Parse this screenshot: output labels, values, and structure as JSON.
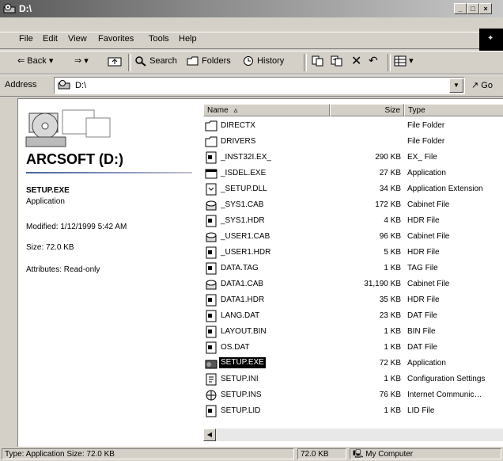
{
  "window": {
    "title": "D:\\"
  },
  "menu": {
    "items": [
      "File",
      "Edit",
      "View",
      "Favorites",
      "Tools",
      "Help"
    ]
  },
  "toolbar": {
    "back_label": "Back",
    "search_label": "Search",
    "folders_label": "Folders",
    "history_label": "History"
  },
  "address": {
    "label": "Address",
    "value": "D:\\",
    "go_label": "Go"
  },
  "left_pane": {
    "drive_title": "ARCSOFT (D:)",
    "selected_name": "SETUP.EXE",
    "selected_type": "Application",
    "modified": "Modified: 1/12/1999 5:42 AM",
    "size": "Size: 72.0 KB",
    "attributes": "Attributes: Read-only"
  },
  "list": {
    "columns": {
      "name": "Name",
      "size": "Size",
      "type": "Type"
    },
    "files": [
      {
        "name": "DIRECTX",
        "size": "",
        "type": "File Folder",
        "icon": "folder-icon"
      },
      {
        "name": "DRIVERS",
        "size": "",
        "type": "File Folder",
        "icon": "folder-icon"
      },
      {
        "name": "_INST32I.EX_",
        "size": "290 KB",
        "type": "EX_ File",
        "icon": "file-icon"
      },
      {
        "name": "_ISDEL.EXE",
        "size": "27 KB",
        "type": "Application",
        "icon": "app-icon"
      },
      {
        "name": "_SETUP.DLL",
        "size": "34 KB",
        "type": "Application Extension",
        "icon": "dll-icon"
      },
      {
        "name": "_SYS1.CAB",
        "size": "172 KB",
        "type": "Cabinet File",
        "icon": "cab-icon"
      },
      {
        "name": "_SYS1.HDR",
        "size": "4 KB",
        "type": "HDR File",
        "icon": "file-icon"
      },
      {
        "name": "_USER1.CAB",
        "size": "96 KB",
        "type": "Cabinet File",
        "icon": "cab-icon"
      },
      {
        "name": "_USER1.HDR",
        "size": "5 KB",
        "type": "HDR File",
        "icon": "file-icon"
      },
      {
        "name": "DATA.TAG",
        "size": "1 KB",
        "type": "TAG File",
        "icon": "file-icon"
      },
      {
        "name": "DATA1.CAB",
        "size": "31,190 KB",
        "type": "Cabinet File",
        "icon": "cab-icon"
      },
      {
        "name": "DATA1.HDR",
        "size": "35 KB",
        "type": "HDR File",
        "icon": "file-icon"
      },
      {
        "name": "LANG.DAT",
        "size": "23 KB",
        "type": "DAT File",
        "icon": "file-icon"
      },
      {
        "name": "LAYOUT.BIN",
        "size": "1 KB",
        "type": "BIN File",
        "icon": "file-icon"
      },
      {
        "name": "OS.DAT",
        "size": "1 KB",
        "type": "DAT File",
        "icon": "file-icon"
      },
      {
        "name": "SETUP.EXE",
        "size": "72 KB",
        "type": "Application",
        "icon": "setup-icon",
        "selected": true
      },
      {
        "name": "SETUP.INI",
        "size": "1 KB",
        "type": "Configuration Settings",
        "icon": "ini-icon"
      },
      {
        "name": "SETUP.INS",
        "size": "76 KB",
        "type": "Internet Communic…",
        "icon": "ins-icon"
      },
      {
        "name": "SETUP.LID",
        "size": "1 KB",
        "type": "LID File",
        "icon": "file-icon"
      }
    ]
  },
  "status": {
    "left": "Type: Application Size: 72.0 KB",
    "middle": "72.0 KB",
    "right": "My Computer"
  }
}
